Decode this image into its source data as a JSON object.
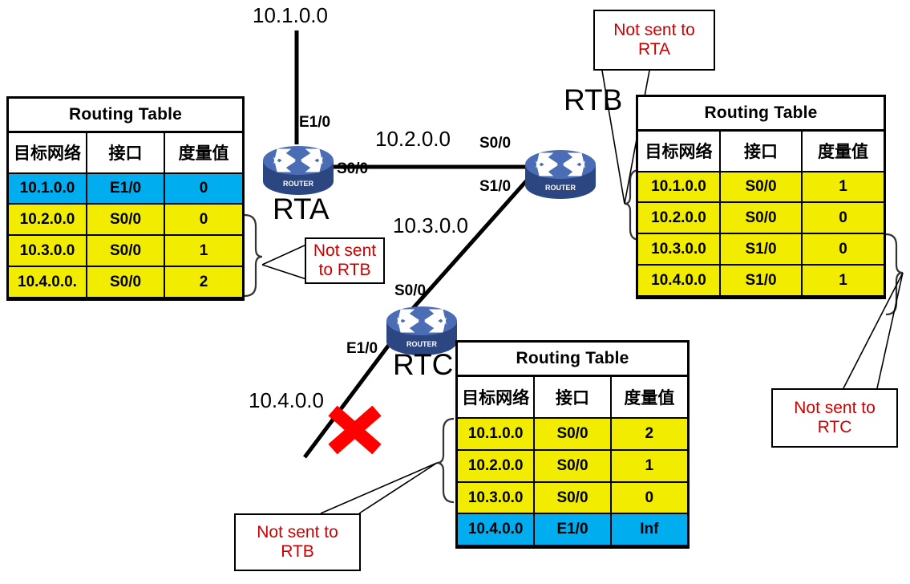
{
  "diagram": {
    "title": "RIP Split Horizon / Route Poisoning Routing Table Diagram",
    "colors": {
      "highlight_blue": "#00AEEF",
      "row_yellow": "#F2ED00",
      "note_red": "#CC0000",
      "router_blue": "#4A6DB5",
      "x_mark_red": "#FF0000"
    }
  },
  "tables": {
    "rta": {
      "title": "Routing Table",
      "headers": [
        "目标网络",
        "接口",
        "度量值"
      ],
      "rows": [
        {
          "network": "10.1.0.0",
          "interface": "E1/0",
          "metric": "0",
          "style": "blue"
        },
        {
          "network": "10.2.0.0",
          "interface": "S0/0",
          "metric": "0",
          "style": "yellow"
        },
        {
          "network": "10.3.0.0",
          "interface": "S0/0",
          "metric": "1",
          "style": "yellow"
        },
        {
          "network": "10.4.0.0.",
          "interface": "S0/0",
          "metric": "2",
          "style": "yellow"
        }
      ]
    },
    "rtb": {
      "title": "Routing Table",
      "headers": [
        "目标网络",
        "接口",
        "度量值"
      ],
      "rows": [
        {
          "network": "10.1.0.0",
          "interface": "S0/0",
          "metric": "1",
          "style": "yellow"
        },
        {
          "network": "10.2.0.0",
          "interface": "S0/0",
          "metric": "0",
          "style": "yellow"
        },
        {
          "network": "10.3.0.0",
          "interface": "S1/0",
          "metric": "0",
          "style": "yellow"
        },
        {
          "network": "10.4.0.0",
          "interface": "S1/0",
          "metric": "1",
          "style": "yellow"
        }
      ]
    },
    "rtc": {
      "title": "Routing Table",
      "headers": [
        "目标网络",
        "接口",
        "度量值"
      ],
      "rows": [
        {
          "network": "10.1.0.0",
          "interface": "S0/0",
          "metric": "2",
          "style": "yellow"
        },
        {
          "network": "10.2.0.0",
          "interface": "S0/0",
          "metric": "1",
          "style": "yellow"
        },
        {
          "network": "10.3.0.0",
          "interface": "S0/0",
          "metric": "0",
          "style": "yellow"
        },
        {
          "network": "10.4.0.0",
          "interface": "E1/0",
          "metric": "Inf",
          "style": "blue"
        }
      ]
    }
  },
  "notes": {
    "not_sent_to_rta": "Not sent to\nRTA",
    "not_sent_to_rtb_top": "Not sent\nto RTB",
    "not_sent_to_rtc": "Not sent to\nRTC",
    "not_sent_to_rtb_bottom": "Not sent to\nRTB"
  },
  "routers": [
    {
      "id": "rta",
      "name": "RTA",
      "icon": "router-icon",
      "icon_caption": "ROUTER"
    },
    {
      "id": "rtb",
      "name": "RTB",
      "icon": "router-icon",
      "icon_caption": "ROUTER"
    },
    {
      "id": "rtc",
      "name": "RTC",
      "icon": "router-icon",
      "icon_caption": "ROUTER"
    }
  ],
  "networks": {
    "n1": "10.1.0.0",
    "n2": "10.2.0.0",
    "n3": "10.3.0.0",
    "n4": "10.4.0.0"
  },
  "interfaces": {
    "rta_e1_0": "E1/0",
    "rta_s0_0": "S0/0",
    "rtb_s0_0": "S0/0",
    "rtb_s1_0": "S1/0",
    "rtc_s0_0": "S0/0",
    "rtc_e1_0": "E1/0"
  },
  "markers": {
    "link_down": "✖"
  }
}
